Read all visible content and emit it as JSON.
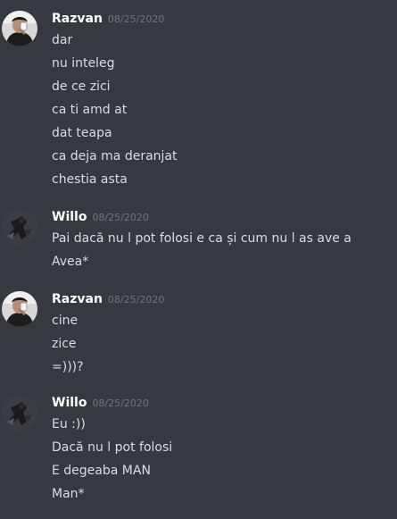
{
  "chat": {
    "messages": [
      {
        "author": "Razvan",
        "timestamp": "08/25/2020",
        "avatar_icon": "razvan-photo-avatar-icon",
        "lines": [
          "dar",
          "nu inteleg",
          "de ce zici",
          "ca ti amd at",
          "dat teapa",
          "ca deja ma deranjat",
          "chestia asta"
        ]
      },
      {
        "author": "Willo",
        "timestamp": "08/25/2020",
        "avatar_icon": "willo-character-avatar-icon",
        "lines": [
          "Pai dacă nu l pot folosi e ca și cum nu l as ave a",
          "Avea*"
        ]
      },
      {
        "author": "Razvan",
        "timestamp": "08/25/2020",
        "avatar_icon": "razvan-photo-avatar-icon",
        "lines": [
          "cine",
          "zice",
          "=)))?"
        ]
      },
      {
        "author": "Willo",
        "timestamp": "08/25/2020",
        "avatar_icon": "willo-character-avatar-icon",
        "lines": [
          "Eu :))",
          "Dacă nu l pot folosi",
          "E degeaba MAN",
          "Man*"
        ]
      }
    ]
  },
  "colors": {
    "background": "#36393f",
    "username": "#ffffff",
    "timestamp": "#72767d",
    "message_text": "#dcddde"
  }
}
